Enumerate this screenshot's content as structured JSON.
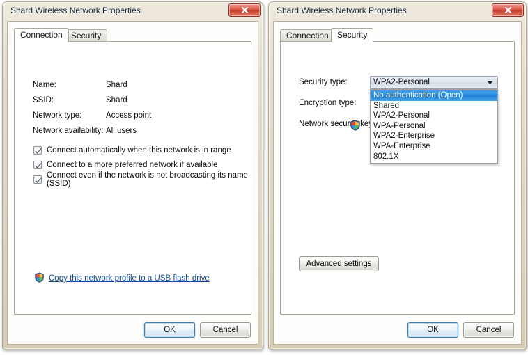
{
  "windows": {
    "left": {
      "title": "Shard Wireless Network Properties",
      "close_label": "Close",
      "tabs": [
        {
          "label": "Connection",
          "active": true
        },
        {
          "label": "Security",
          "active": false
        }
      ],
      "connection": {
        "fields": [
          {
            "label": "Name:",
            "value": "Shard"
          },
          {
            "label": "SSID:",
            "value": "Shard"
          },
          {
            "label": "Network type:",
            "value": "Access point"
          },
          {
            "label": "Network availability:",
            "value": "All users"
          }
        ],
        "checkboxes": [
          {
            "label": "Connect automatically when this network is in range",
            "checked": true
          },
          {
            "label": "Connect to a more preferred network if available",
            "checked": true
          },
          {
            "label": "Connect even if the network is not broadcasting its name (SSID)",
            "checked": true
          }
        ],
        "profile_link": "Copy this network profile to a USB flash drive",
        "profile_link_icon": "uac-shield-icon"
      },
      "footer": {
        "ok_label": "OK",
        "cancel_label": "Cancel"
      }
    },
    "right": {
      "title": "Shard Wireless Network Properties",
      "close_label": "Close",
      "tabs": [
        {
          "label": "Connection",
          "active": false
        },
        {
          "label": "Security",
          "active": true
        }
      ],
      "security": {
        "labels": [
          "Security type:",
          "Encryption type:",
          "Network security key"
        ],
        "security_type_value": "WPA2-Personal",
        "security_type_options": [
          "No authentication (Open)",
          "Shared",
          "WPA2-Personal",
          "WPA-Personal",
          "WPA2-Enterprise",
          "WPA-Enterprise",
          "802.1X"
        ],
        "security_type_highlighted": "No authentication (Open)",
        "shield_icon": "uac-shield-icon",
        "advanced_label": "Advanced settings"
      },
      "footer": {
        "ok_label": "OK",
        "cancel_label": "Cancel"
      }
    }
  },
  "colors": {
    "window_frame": "#ded6c4",
    "close_red": "#c33c2c",
    "link_blue": "#0b4b93",
    "selection_blue": "#2a8ce0",
    "default_button_border": "#3c7fb1"
  }
}
